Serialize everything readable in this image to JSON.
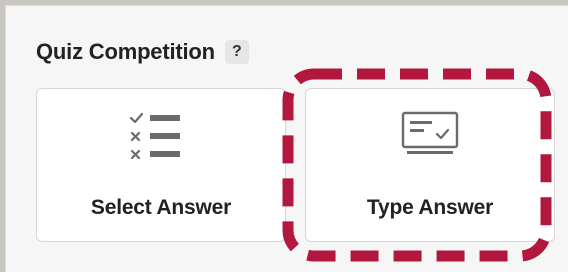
{
  "section": {
    "title": "Quiz Competition",
    "help_glyph": "?"
  },
  "options": [
    {
      "label": "Select Answer",
      "icon": "checklist-icon"
    },
    {
      "label": "Type Answer",
      "icon": "text-input-icon"
    }
  ],
  "highlight": {
    "target": "Type Answer",
    "color": "#b2173d",
    "style": "dashed"
  },
  "colors": {
    "background": "#c9c6c2",
    "panel": "#f6f6f6",
    "card": "#ffffff",
    "text": "#222222",
    "icon": "#6b6b6b"
  }
}
